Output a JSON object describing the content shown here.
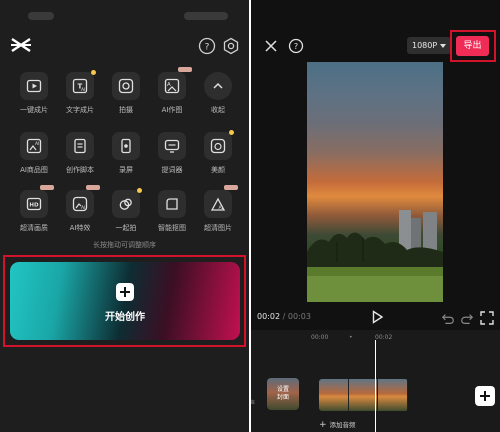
{
  "left_panel": {
    "grid_rows": [
      [
        {
          "label": "一键成片",
          "icon": "play-icon"
        },
        {
          "label": "文字成片",
          "icon": "text-to-video-icon"
        },
        {
          "label": "拍摄",
          "icon": "camera-icon"
        },
        {
          "label": "AI作图",
          "icon": "ai-image-icon"
        },
        {
          "label": "收起",
          "icon": "chevron-up-icon"
        }
      ],
      [
        {
          "label": "AI商品图",
          "icon": "ai-product-image-icon"
        },
        {
          "label": "创作脚本",
          "icon": "script-icon"
        },
        {
          "label": "录屏",
          "icon": "screen-record-icon"
        },
        {
          "label": "提词器",
          "icon": "teleprompter-icon"
        },
        {
          "label": "美颜",
          "icon": "beauty-icon"
        }
      ],
      [
        {
          "label": "超清画质",
          "icon": "hd-quality-icon"
        },
        {
          "label": "AI特效",
          "icon": "ai-effects-icon"
        },
        {
          "label": "一起拍",
          "icon": "shoot-together-icon"
        },
        {
          "label": "智能抠图",
          "icon": "smart-cutout-icon"
        },
        {
          "label": "超清图片",
          "icon": "hd-image-icon"
        }
      ]
    ],
    "hint": "长按拖动可调整顺序",
    "create_label": "开始创作"
  },
  "editor": {
    "resolution": "1080P",
    "export_label": "导出",
    "time_current": "00:02",
    "time_separator": "/",
    "time_total": "00:03",
    "ruler_ticks": [
      "00:00",
      "•",
      "00:02"
    ],
    "cover_label": "设置\n封面",
    "add_audio_label": "添加音频",
    "side_label": "声"
  },
  "colors": {
    "accent": "#ee2c55",
    "highlight_outline": "#d1132c",
    "badge_dot": "#f5c84b"
  }
}
